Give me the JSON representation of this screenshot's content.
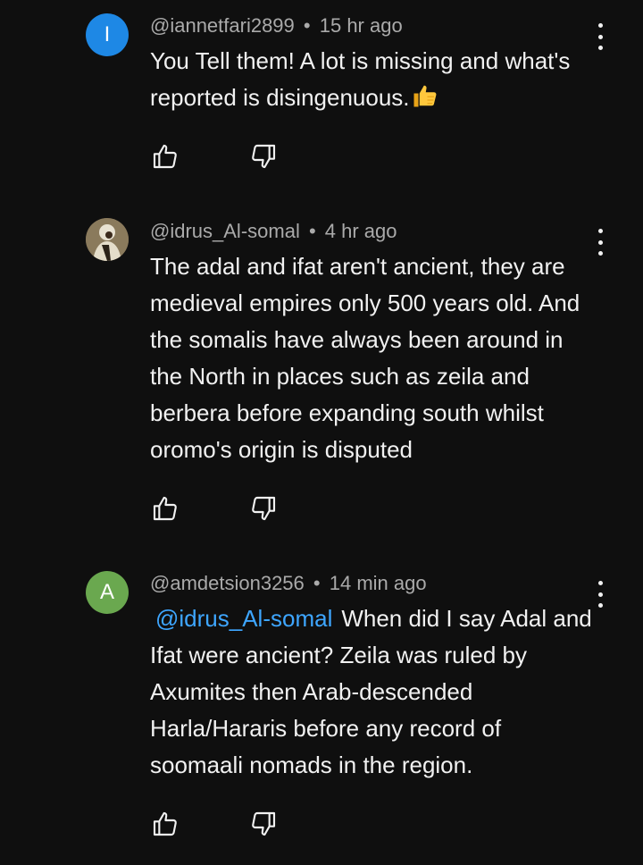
{
  "comments": [
    {
      "avatar_letter": "I",
      "avatar_color": "#1e88e5",
      "handle": "@iannetfari2899",
      "separator": "•",
      "time": "15 hr ago",
      "text": "You Tell them! A lot is missing and what's reported is disingenuous.",
      "emoji": "thumbs-up-emoji"
    },
    {
      "avatar_letter": "",
      "avatar_color": "#6b5d44",
      "handle": "@idrus_Al-somal",
      "separator": "•",
      "time": "4 hr ago",
      "text": "The adal and ifat aren't ancient, they are medieval empires only 500 years old. And the somalis have always been around in the North in places such as zeila and berbera before expanding south whilst oromo's origin is disputed"
    },
    {
      "avatar_letter": "A",
      "avatar_color": "#6aa84f",
      "handle": "@amdetsion3256",
      "separator": "•",
      "time": "14 min ago",
      "mention": "@idrus_Al-somal",
      "text": "When did I say Adal and Ifat were ancient? Zeila was ruled by Axumites then Arab-descended Harla/Hararis before any record of soomaali nomads in the region."
    }
  ]
}
